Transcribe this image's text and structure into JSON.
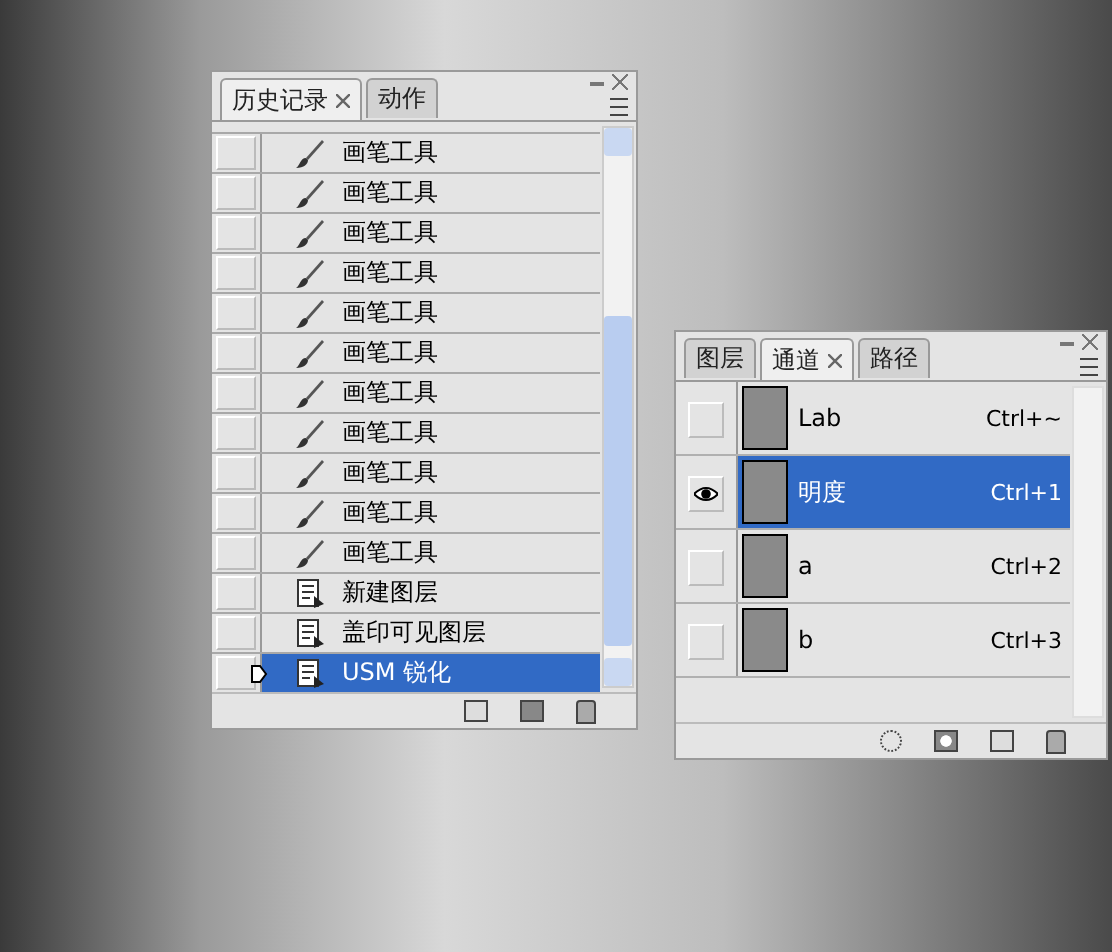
{
  "history_panel": {
    "tabs": [
      {
        "label": "历史记录",
        "selected": true,
        "closable": true
      },
      {
        "label": "动作",
        "selected": false,
        "closable": false
      }
    ],
    "items": [
      {
        "kind": "brush",
        "label": "画笔工具",
        "selected": false,
        "source": false
      },
      {
        "kind": "brush",
        "label": "画笔工具",
        "selected": false,
        "source": false
      },
      {
        "kind": "brush",
        "label": "画笔工具",
        "selected": false,
        "source": false
      },
      {
        "kind": "brush",
        "label": "画笔工具",
        "selected": false,
        "source": false
      },
      {
        "kind": "brush",
        "label": "画笔工具",
        "selected": false,
        "source": false
      },
      {
        "kind": "brush",
        "label": "画笔工具",
        "selected": false,
        "source": false
      },
      {
        "kind": "brush",
        "label": "画笔工具",
        "selected": false,
        "source": false
      },
      {
        "kind": "brush",
        "label": "画笔工具",
        "selected": false,
        "source": false
      },
      {
        "kind": "brush",
        "label": "画笔工具",
        "selected": false,
        "source": false
      },
      {
        "kind": "brush",
        "label": "画笔工具",
        "selected": false,
        "source": false
      },
      {
        "kind": "brush",
        "label": "画笔工具",
        "selected": false,
        "source": false
      },
      {
        "kind": "document",
        "label": "新建图层",
        "selected": false,
        "source": false
      },
      {
        "kind": "document",
        "label": "盖印可见图层",
        "selected": false,
        "source": false
      },
      {
        "kind": "document",
        "label": "USM 锐化",
        "selected": true,
        "source": false
      }
    ]
  },
  "channels_panel": {
    "tabs": [
      {
        "label": "图层",
        "selected": false,
        "closable": false
      },
      {
        "label": "通道",
        "selected": true,
        "closable": true
      },
      {
        "label": "路径",
        "selected": false,
        "closable": false
      }
    ],
    "channels": [
      {
        "name": "Lab",
        "shortcut": "Ctrl+~",
        "visible": false,
        "selected": false
      },
      {
        "name": "明度",
        "shortcut": "Ctrl+1",
        "visible": true,
        "selected": true
      },
      {
        "name": "a",
        "shortcut": "Ctrl+2",
        "visible": false,
        "selected": false
      },
      {
        "name": "b",
        "shortcut": "Ctrl+3",
        "visible": false,
        "selected": false
      }
    ]
  }
}
